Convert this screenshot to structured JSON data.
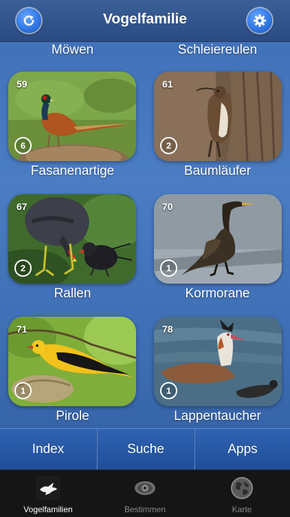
{
  "header": {
    "title": "Vogelfamilie",
    "refresh_icon": "refresh-icon",
    "settings_icon": "gear-icon"
  },
  "top_labels": [
    "Möwen",
    "Schleiereulen"
  ],
  "families": [
    {
      "name": "Fasanenartige",
      "number": "59",
      "count": "6"
    },
    {
      "name": "Baumläufer",
      "number": "61",
      "count": "2"
    },
    {
      "name": "Rallen",
      "number": "67",
      "count": "2"
    },
    {
      "name": "Kormorane",
      "number": "70",
      "count": "1"
    },
    {
      "name": "Pirole",
      "number": "71",
      "count": "1"
    },
    {
      "name": "Lappentaucher",
      "number": "78",
      "count": "1"
    }
  ],
  "bottom_buttons": [
    "Index",
    "Suche",
    "Apps"
  ],
  "tabs": [
    {
      "label": "Vogelfamilien",
      "icon": "bird-icon",
      "active": true
    },
    {
      "label": "Bestimmen",
      "icon": "eye-icon",
      "active": false
    },
    {
      "label": "Karte",
      "icon": "globe-icon",
      "active": false
    }
  ]
}
